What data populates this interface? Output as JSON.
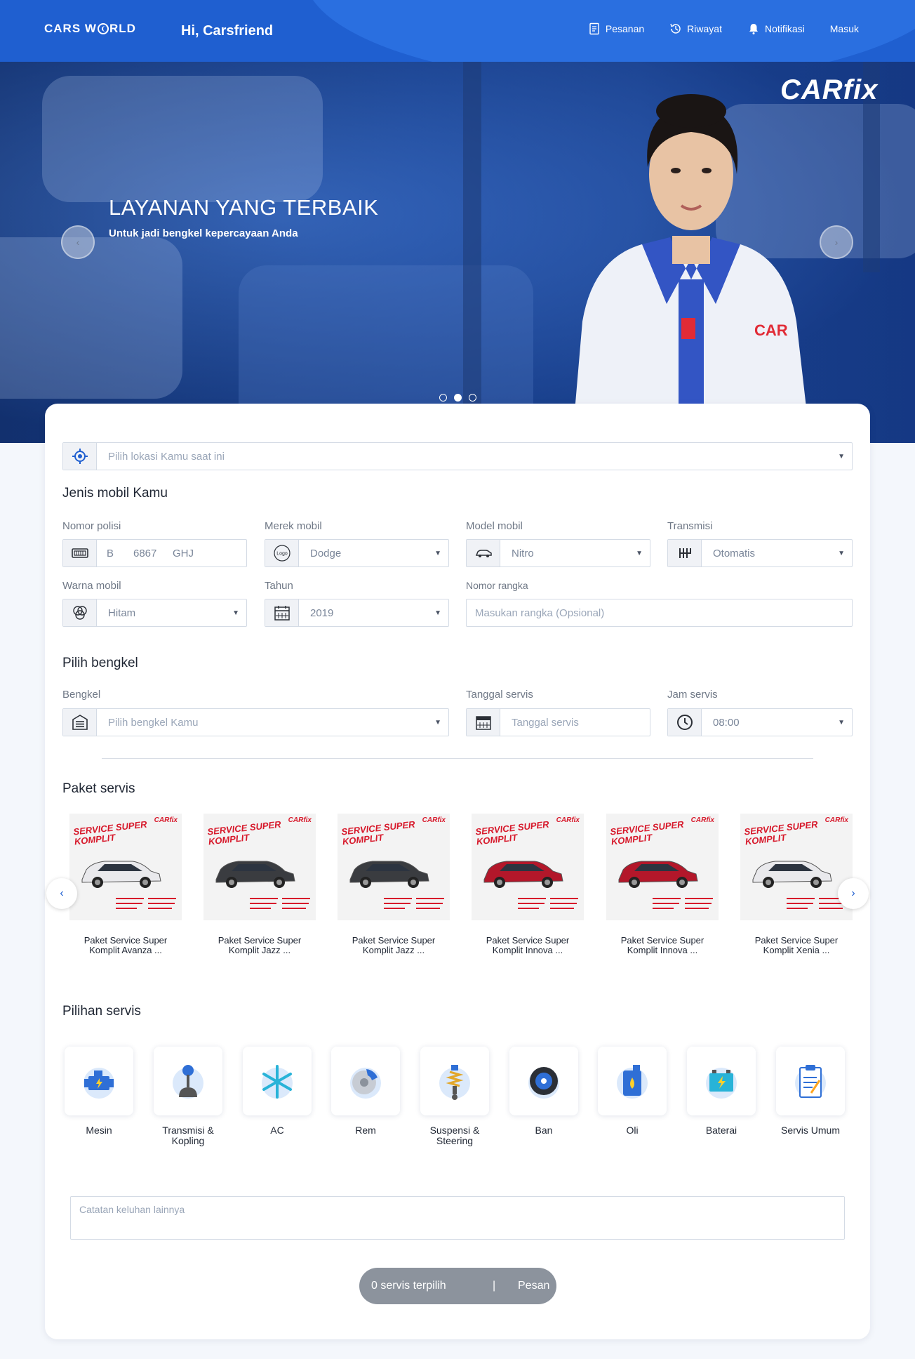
{
  "header": {
    "logo": "CARS WORLD",
    "logo_left": "CARS W",
    "logo_right": "RLD",
    "greeting": "Hi, Carsfriend",
    "menu": [
      {
        "label": "Pesanan",
        "icon": "order-icon"
      },
      {
        "label": "Riwayat",
        "icon": "history-icon"
      },
      {
        "label": "Notifikasi",
        "icon": "bell-icon"
      },
      {
        "label": "Masuk",
        "icon": ""
      }
    ],
    "brand_color": "#1f5fd0"
  },
  "hero": {
    "title": "LAYANAN YANG TERBAIK",
    "subtitle": "Untuk jadi bengkel kepercayaan Anda",
    "brand": "CARfix",
    "uniform_text": "CAR",
    "prev_label": "‹",
    "next_label": "›",
    "active_slide": 2,
    "slide_count": 3
  },
  "location": {
    "placeholder": "Pilih lokasi Kamu saat ini"
  },
  "car": {
    "section_title": "Jenis mobil Kamu",
    "plate_label": "Nomor polisi",
    "plate_prefix": "B",
    "plate_number": "6867",
    "plate_suffix": "GHJ",
    "brand_label": "Merek mobil",
    "brand_logo": "Logo",
    "brand_value": "Dodge",
    "model_label": "Model mobil",
    "model_value": "Nitro",
    "transmission_label": "Transmisi",
    "transmission_value": "Otomatis",
    "color_label": "Warna mobil",
    "color_value": "Hitam",
    "year_label": "Tahun",
    "year_value": "2019",
    "chassis_label": "Nomor rangka",
    "chassis_placeholder": "Masukan rangka (Opsional)"
  },
  "workshop": {
    "section_title": "Pilih bengkel",
    "workshop_label": "Bengkel",
    "workshop_placeholder": "Pilih bengkel Kamu",
    "date_label": "Tanggal servis",
    "date_placeholder": "Tanggal servis",
    "time_label": "Jam servis",
    "time_value": "08:00"
  },
  "packages": {
    "section_title": "Paket servis",
    "promo_tag_line1": "SERVICE SUPER",
    "promo_tag_line2": "KOMPLIT",
    "promo_brand": "CARfix",
    "prev_label": "‹",
    "next_label": "›",
    "items": [
      {
        "line1": "Paket Service Super",
        "line2": "Komplit Avanza ...",
        "car_color": "#e9e9ec"
      },
      {
        "line1": "Paket Service Super",
        "line2": "Komplit Jazz ...",
        "car_color": "#3a3c40"
      },
      {
        "line1": "Paket Service Super",
        "line2": "Komplit Jazz ...",
        "car_color": "#3a3c40"
      },
      {
        "line1": "Paket Service Super",
        "line2": "Komplit Innova ...",
        "car_color": "#b3172a"
      },
      {
        "line1": "Paket Service Super",
        "line2": "Komplit Innova ...",
        "car_color": "#b3172a"
      },
      {
        "line1": "Paket Service Super",
        "line2": "Komplit Xenia ...",
        "car_color": "#e9e9ec"
      }
    ]
  },
  "services": {
    "section_title": "Pilihan servis",
    "items": [
      {
        "line1": "Mesin",
        "line2": "",
        "icon": "engine-icon"
      },
      {
        "line1": "Transmisi &",
        "line2": "Kopling",
        "icon": "gear-shift-icon"
      },
      {
        "line1": "AC",
        "line2": "",
        "icon": "snowflake-icon"
      },
      {
        "line1": "Rem",
        "line2": "",
        "icon": "brake-icon"
      },
      {
        "line1": "Suspensi &",
        "line2": "Steering",
        "icon": "suspension-icon"
      },
      {
        "line1": "Ban",
        "line2": "",
        "icon": "tire-icon"
      },
      {
        "line1": "Oli",
        "line2": "",
        "icon": "oil-icon"
      },
      {
        "line1": "Baterai",
        "line2": "",
        "icon": "battery-icon"
      },
      {
        "line1": "Servis Umum",
        "line2": "",
        "icon": "clipboard-icon"
      }
    ]
  },
  "notes": {
    "placeholder": "Catatan keluhan lainnya"
  },
  "footer": {
    "selected_text": "0 servis terpilih",
    "separator": "|",
    "order_label": "Pesan"
  }
}
